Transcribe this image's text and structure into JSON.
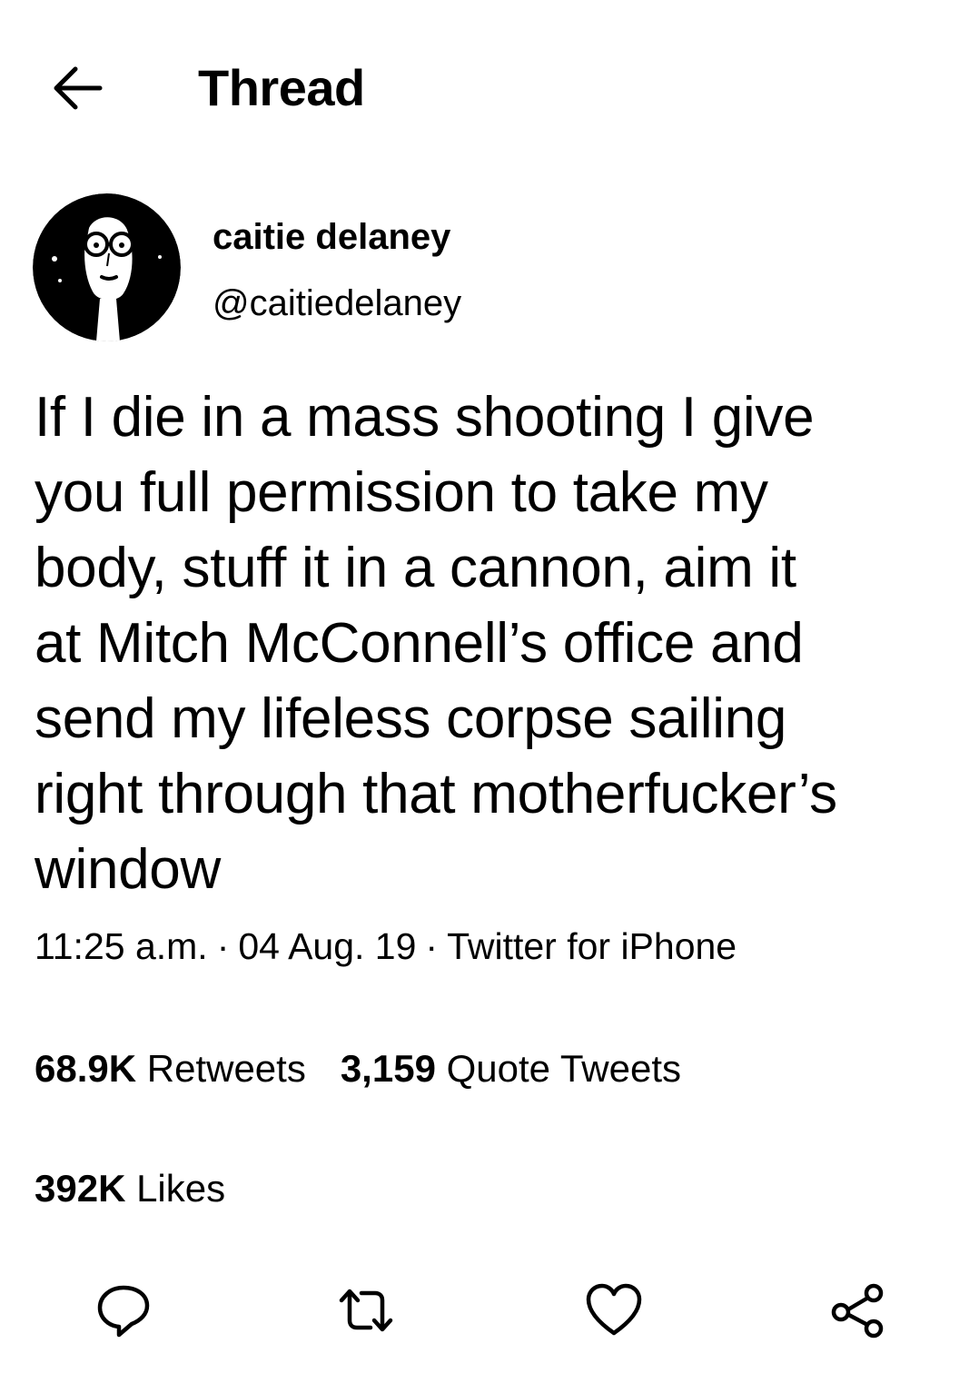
{
  "header": {
    "title": "Thread",
    "back_icon": "arrow-left-icon"
  },
  "author": {
    "display_name": "caitie delaney",
    "handle": "@caitiedelaney",
    "avatar_icon": "avatar-photo"
  },
  "tweet": {
    "text": "If I die in a mass shooting I give\nyou full permission to take my\nbody, stuff it in a cannon, aim it\nat Mitch McConnell’s office and\nsend my lifeless corpse sailing\nright through that motherfucker’s\nwindow",
    "time": "11:25 a.m.",
    "date": "04 Aug. 19",
    "source": "Twitter for iPhone",
    "separator": "·"
  },
  "stats": {
    "retweets_count": "68.9K",
    "retweets_label": "Retweets",
    "quotes_count": "3,159",
    "quotes_label": "Quote Tweets",
    "likes_count": "392K",
    "likes_label": "Likes"
  },
  "actions": {
    "reply_icon": "reply-icon",
    "retweet_icon": "retweet-icon",
    "like_icon": "heart-icon",
    "share_icon": "share-icon"
  },
  "colors": {
    "background": "#ffffff",
    "text": "#000000"
  }
}
